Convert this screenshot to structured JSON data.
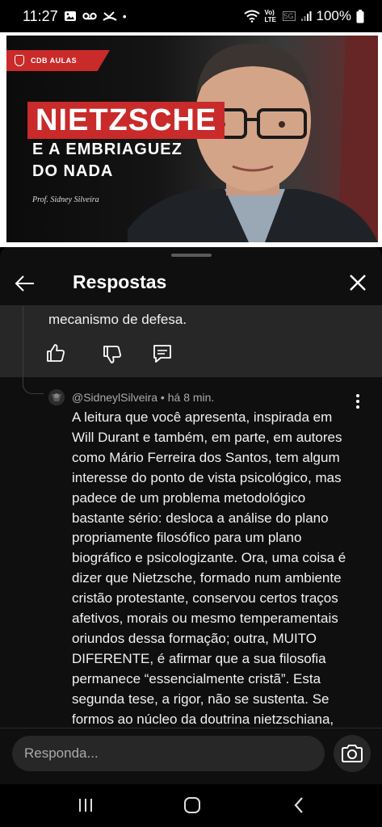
{
  "status_bar": {
    "time": "11:27",
    "dot": "•",
    "network_label": "Vo) LTE",
    "signal_label": "5G",
    "battery_percent": "100%",
    "left_icons": [
      "image-icon",
      "voicemail-icon",
      "missed-call-icon"
    ],
    "right_icons": [
      "wifi-icon",
      "signal-icon",
      "battery-icon"
    ]
  },
  "video": {
    "brand": "CDB AULAS",
    "title": "NIETZSCHE",
    "subtitle_line1": "E A EMBRIAGUEZ",
    "subtitle_line2": "DO NADA",
    "professor": "Prof. Sidney Silveira",
    "accent_color": "#c92a2a"
  },
  "header": {
    "title": "Respostas"
  },
  "previous_reply": {
    "text": "mecanismo de defesa."
  },
  "reply": {
    "author": "@SidneylSilveira",
    "separator": " • ",
    "time": "há 8 min.",
    "text": "A leitura que você apresenta, inspirada em Will Durant e também, em parte, em autores como Mário Ferreira dos Santos, tem algum interesse do ponto de vista psicológico, mas padece de um problema metodológico bastante sério: desloca a análise do plano propriamente filosófico para um plano biográfico e psicologizante. Ora, uma coisa é dizer que Nietzsche, formado num ambiente cristão protestante, conservou certos traços afetivos, morais ou mesmo temperamentais oriundos dessa formação; outra, MUITO DIFERENTE, é afirmar que a sua filosofia permanece “essencialmente cristã”. Esta segunda tese, a rigor, não se sustenta. Se formos ao núcleo da doutrina nietzschiana,"
  },
  "reply_box": {
    "placeholder": "Responda..."
  },
  "theme": {
    "panel_bg": "#0f0f0f",
    "highlight_bg": "#272727",
    "text_primary": "#f1f1f1",
    "text_secondary": "#aaaaaa"
  }
}
